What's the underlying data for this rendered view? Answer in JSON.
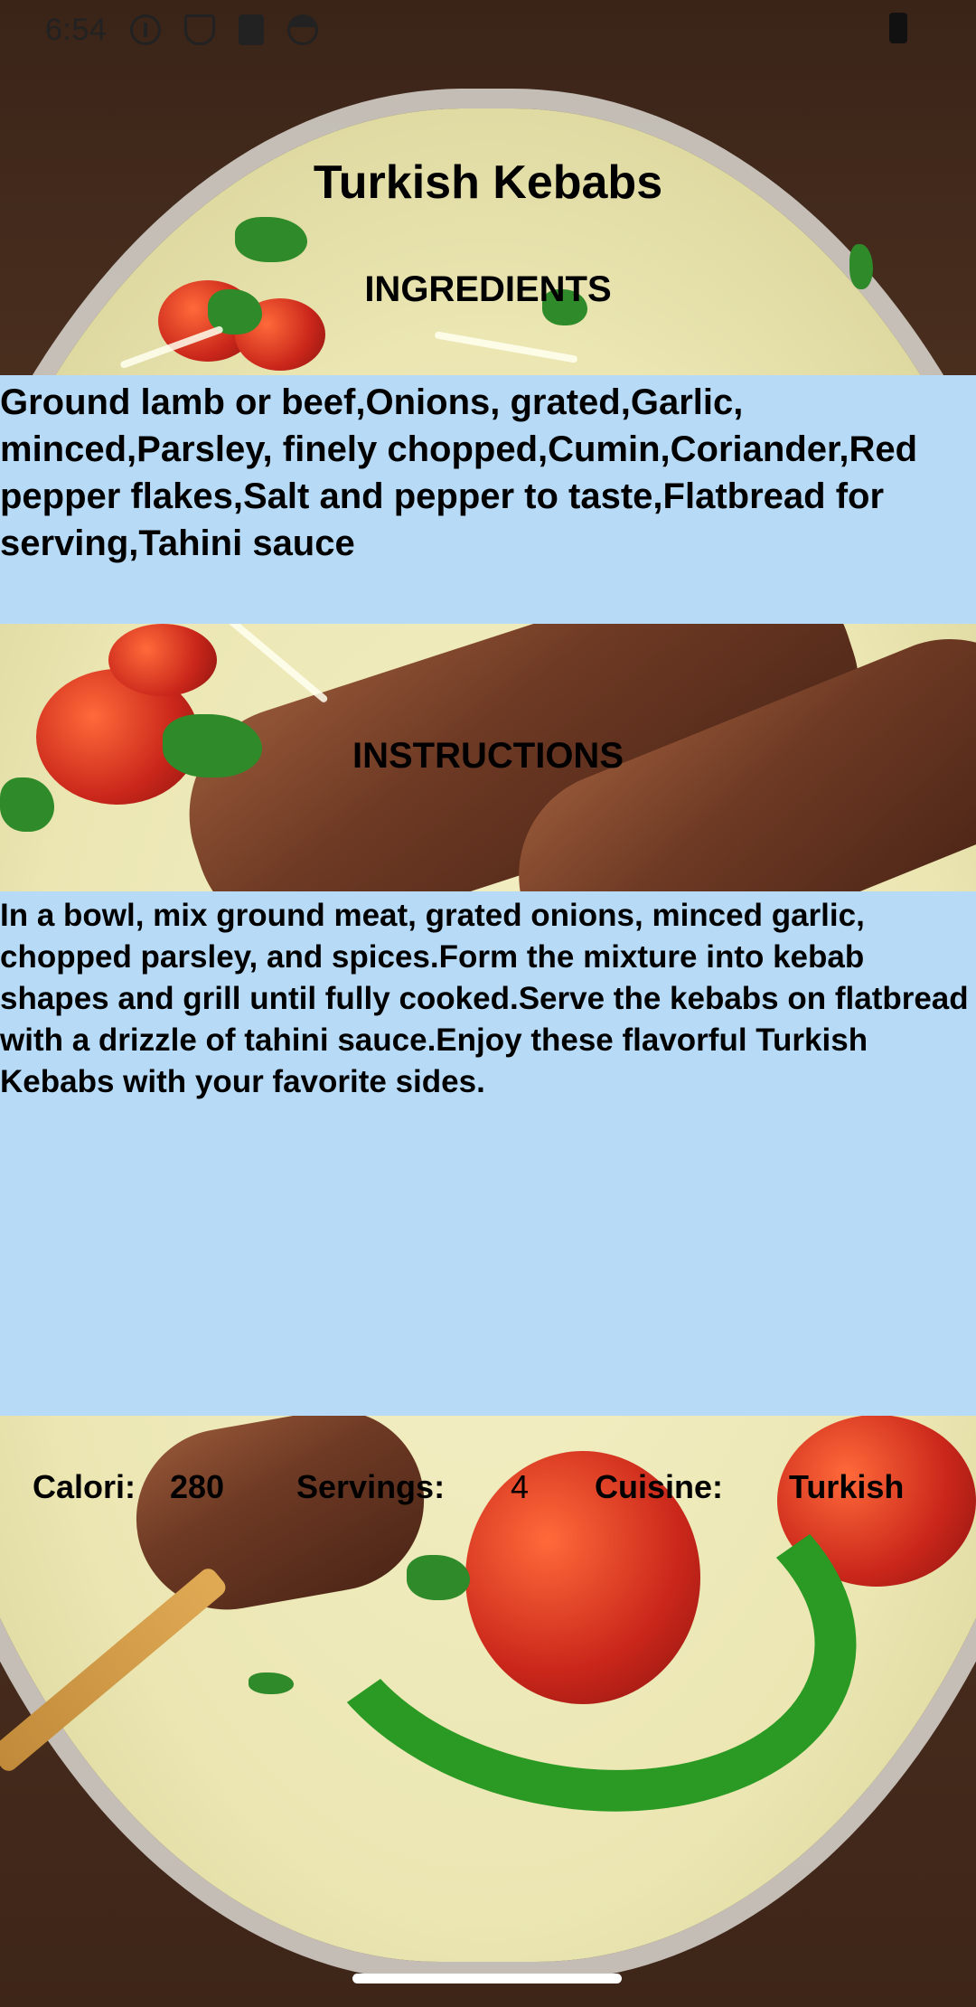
{
  "status_bar": {
    "time": "6:54",
    "icons": [
      "info-icon",
      "shield-icon",
      "sd-card-icon",
      "face-icon",
      "battery-icon"
    ]
  },
  "recipe": {
    "title": "Turkish Kebabs",
    "ingredients_heading": "INGREDIENTS",
    "ingredients": "Ground lamb or beef,Onions, grated,Garlic, minced,Parsley, finely chopped,Cumin,Coriander,Red pepper flakes,Salt and pepper to taste,Flatbread for serving,Tahini sauce",
    "instructions_heading": "INSTRUCTIONS",
    "instructions": "In a bowl, mix ground meat, grated onions, minced garlic, chopped parsley, and spices.Form the mixture into kebab shapes and grill until fully cooked.Serve the kebabs on flatbread with a drizzle of tahini sauce.Enjoy these flavorful Turkish Kebabs with your favorite sides."
  },
  "stats": {
    "calori_label": "Calori:",
    "calori_value": "280",
    "servings_label": "Servings:",
    "servings_value": "4",
    "cuisine_label": "Cuisine:",
    "cuisine_value": "Turkish"
  },
  "colors": {
    "panel_bg": "#b7dbf7",
    "text": "#000000"
  }
}
